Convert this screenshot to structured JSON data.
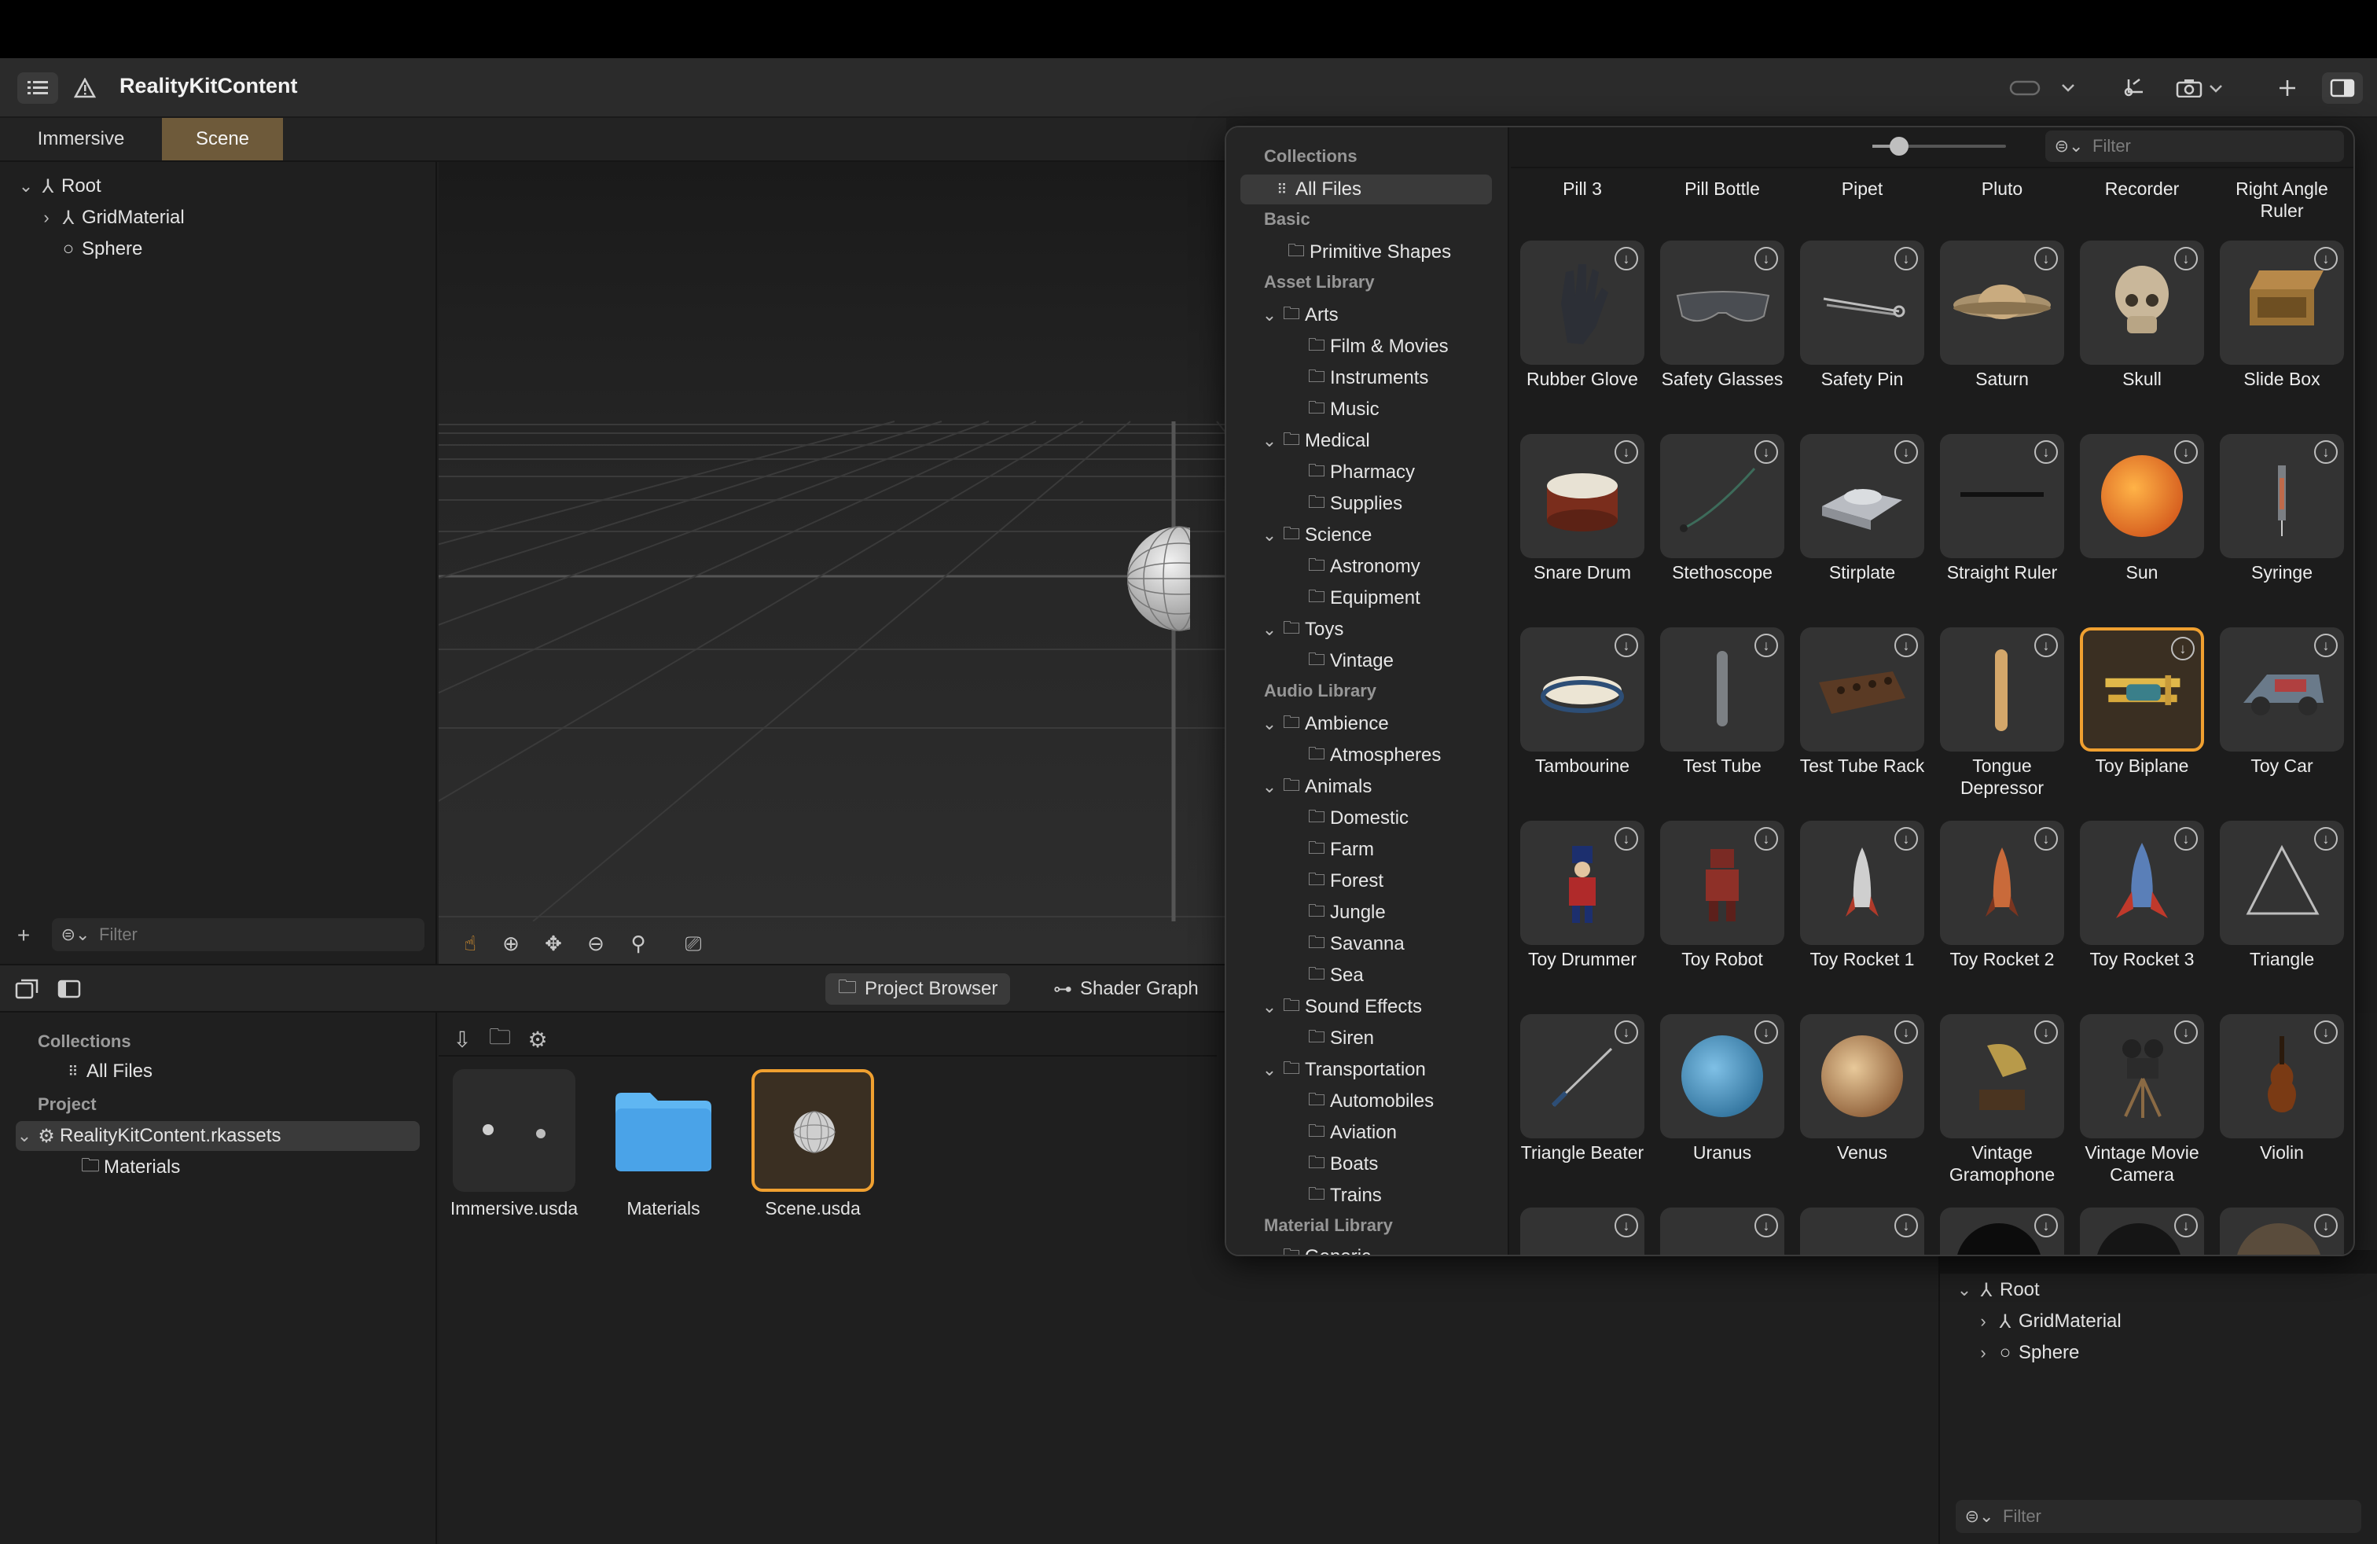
{
  "toolbar": {
    "title": "RealityKitContent",
    "sidebar_icon": "sidebar-list-icon",
    "warning_icon": "warning-icon",
    "add_icon": "plus-icon",
    "camera_icon": "camera-icon"
  },
  "tabs": [
    {
      "label": "Immersive"
    },
    {
      "label": "Scene"
    }
  ],
  "scene_tree": [
    {
      "label": "Root"
    },
    {
      "label": "GridMaterial"
    },
    {
      "label": "Sphere"
    }
  ],
  "left_filter_placeholder": "Filter",
  "bottom_tabs": {
    "project_browser": "Project Browser",
    "shader_graph": "Shader Graph"
  },
  "project_sidebar": {
    "collections_head": "Collections",
    "all_files": "All Files",
    "project_head": "Project",
    "rkassets": "RealityKitContent.rkassets",
    "materials": "Materials"
  },
  "project_files": [
    {
      "label": "Immersive.usda"
    },
    {
      "label": "Materials"
    },
    {
      "label": "Scene.usda"
    }
  ],
  "inspector_tree": [
    {
      "label": "Root"
    },
    {
      "label": "GridMaterial"
    },
    {
      "label": "Sphere"
    }
  ],
  "inspector_filter_placeholder": "Filter",
  "popover": {
    "filter_placeholder": "Filter",
    "sidebar": {
      "collections": "Collections",
      "all_files": "All Files",
      "basic": "Basic",
      "primitive_shapes": "Primitive Shapes",
      "asset_library": "Asset Library",
      "arts": "Arts",
      "film_movies": "Film & Movies",
      "instruments": "Instruments",
      "music": "Music",
      "medical": "Medical",
      "pharmacy": "Pharmacy",
      "supplies": "Supplies",
      "science": "Science",
      "astronomy": "Astronomy",
      "equipment": "Equipment",
      "toys": "Toys",
      "vintage": "Vintage",
      "audio_library": "Audio Library",
      "ambience": "Ambience",
      "atmospheres": "Atmospheres",
      "animals": "Animals",
      "domestic": "Domestic",
      "farm": "Farm",
      "forest": "Forest",
      "jungle": "Jungle",
      "savanna": "Savanna",
      "sea": "Sea",
      "sound_effects": "Sound Effects",
      "siren": "Siren",
      "transportation": "Transportation",
      "automobiles": "Automobiles",
      "aviation": "Aviation",
      "boats": "Boats",
      "trains": "Trains",
      "material_library": "Material Library",
      "generic": "Generic"
    },
    "top_row": [
      "Pill 3",
      "Pill Bottle",
      "Pipet",
      "Pluto",
      "Recorder",
      "Right Angle Ruler"
    ],
    "assets": [
      {
        "label": "Rubber Glove",
        "icon": "rubber-glove"
      },
      {
        "label": "Safety Glasses",
        "icon": "safety-glasses"
      },
      {
        "label": "Safety Pin",
        "icon": "safety-pin"
      },
      {
        "label": "Saturn",
        "icon": "saturn"
      },
      {
        "label": "Skull",
        "icon": "skull"
      },
      {
        "label": "Slide Box",
        "icon": "slide-box"
      },
      {
        "label": "Snare Drum",
        "icon": "snare-drum"
      },
      {
        "label": "Stethoscope",
        "icon": "stethoscope"
      },
      {
        "label": "Stirplate",
        "icon": "stirplate"
      },
      {
        "label": "Straight Ruler",
        "icon": "straight-ruler"
      },
      {
        "label": "Sun",
        "icon": "sun"
      },
      {
        "label": "Syringe",
        "icon": "syringe"
      },
      {
        "label": "Tambourine",
        "icon": "tambourine"
      },
      {
        "label": "Test Tube",
        "icon": "test-tube"
      },
      {
        "label": "Test Tube Rack",
        "icon": "test-tube-rack"
      },
      {
        "label": "Tongue Depressor",
        "icon": "tongue-depressor"
      },
      {
        "label": "Toy Biplane",
        "icon": "toy-biplane"
      },
      {
        "label": "Toy Car",
        "icon": "toy-car"
      },
      {
        "label": "Toy Drummer",
        "icon": "toy-drummer"
      },
      {
        "label": "Toy Robot",
        "icon": "toy-robot"
      },
      {
        "label": "Toy Rocket 1",
        "icon": "toy-rocket"
      },
      {
        "label": "Toy Rocket 2",
        "icon": "toy-rocket"
      },
      {
        "label": "Toy Rocket 3",
        "icon": "toy-rocket"
      },
      {
        "label": "Triangle",
        "icon": "triangle"
      },
      {
        "label": "Triangle Beater",
        "icon": "triangle-beater"
      },
      {
        "label": "Uranus",
        "icon": "uranus"
      },
      {
        "label": "Venus",
        "icon": "venus"
      },
      {
        "label": "Vintage Gramophone",
        "icon": "gramophone"
      },
      {
        "label": "Vintage Movie Camera",
        "icon": "movie-camera"
      },
      {
        "label": "Violin",
        "icon": "violin"
      }
    ],
    "selected_asset": "Toy Biplane"
  },
  "colors": {
    "accent": "#f0a030",
    "selected_tab": "#6e5a3a",
    "folder_blue": "#4aa3e8"
  }
}
